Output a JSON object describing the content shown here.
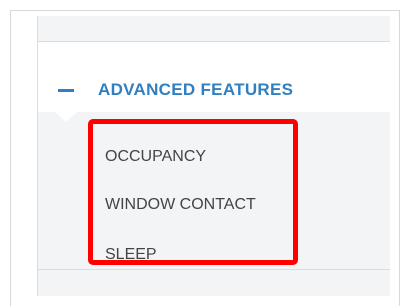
{
  "advanced_features": {
    "title": "ADVANCED FEATURES",
    "collapse_icon": "minus-icon",
    "accent_color": "#2f7fc1",
    "items": [
      {
        "label": "OCCUPANCY"
      },
      {
        "label": "WINDOW CONTACT"
      },
      {
        "label": "SLEEP"
      }
    ]
  },
  "highlight": {
    "color": "#ff0000"
  }
}
